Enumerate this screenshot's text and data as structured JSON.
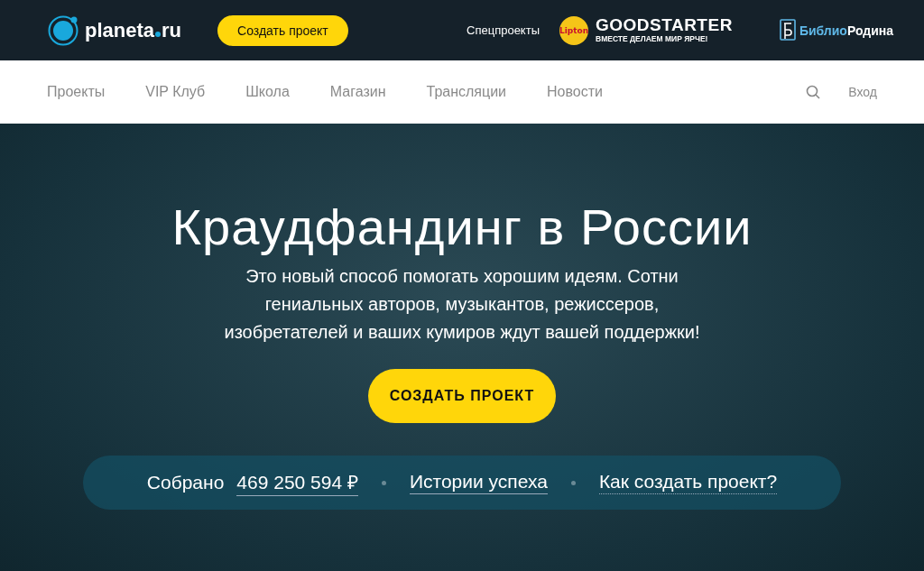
{
  "topbar": {
    "logo": "planeta",
    "logo_suffix": "ru",
    "create_button": "Создать проект",
    "special_label": "Спецпроекты",
    "lipton_badge": "Lipton",
    "goodstarter_title": "GOODSTARTER",
    "goodstarter_slogan": "ВМЕСТЕ ДЕЛАЕМ МИР ЯРЧЕ!",
    "biblio_accent": "Библио",
    "biblio_rest": "Родина"
  },
  "nav": {
    "items": [
      {
        "label": "Проекты"
      },
      {
        "label": "VIP Клуб"
      },
      {
        "label": "Школа"
      },
      {
        "label": "Магазин"
      },
      {
        "label": "Трансляции"
      },
      {
        "label": "Новости"
      }
    ],
    "login": "Вход"
  },
  "hero": {
    "title": "Краудфандинг в России",
    "subtitle": "Это новый способ помогать хорошим идеям. Сотни гениальных авторов, музыкантов, режиссеров, изобретателей и ваших кумиров ждут вашей поддержки!",
    "cta": "СОЗДАТЬ ПРОЕКТ"
  },
  "stats": {
    "collected_label": "Собрано",
    "collected_value": "469 250 594 ₽",
    "links": [
      "Истории успеха",
      "Как создать проект?"
    ]
  }
}
